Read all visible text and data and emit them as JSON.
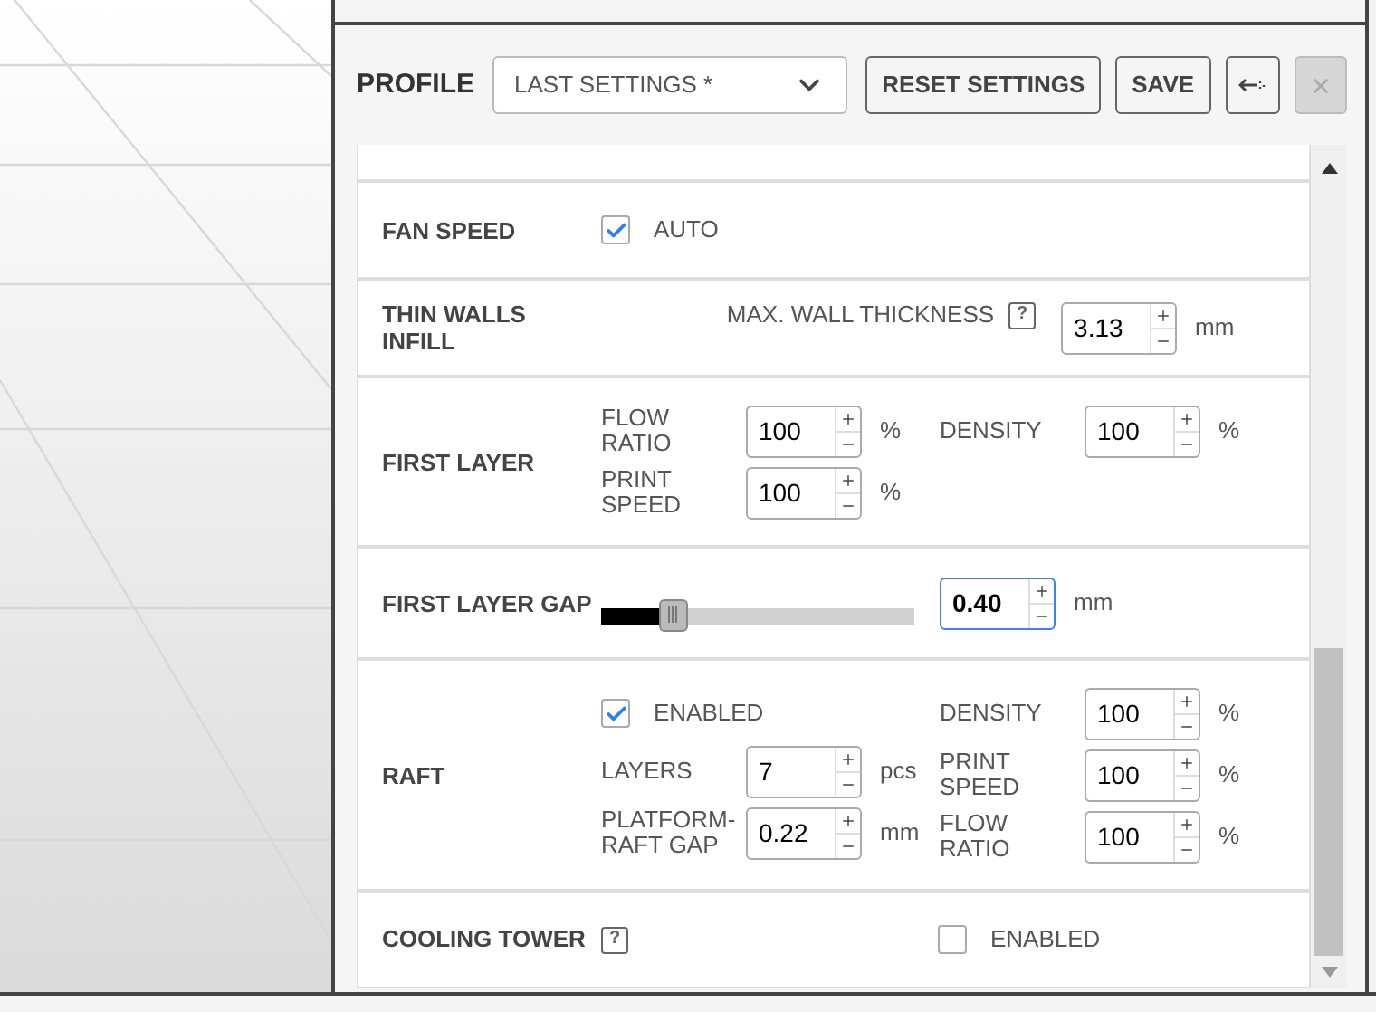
{
  "profile": {
    "label": "PROFILE",
    "selector": {
      "value": "LAST SETTINGS *"
    },
    "buttons": [
      {
        "kind": "text",
        "label": "RESET SETTINGS",
        "disabled": false
      },
      {
        "kind": "text",
        "label": "SAVE",
        "disabled": false
      },
      {
        "kind": "export",
        "disabled": false
      },
      {
        "kind": "close",
        "disabled": true
      }
    ]
  },
  "sections": [
    {
      "kind": "check",
      "title": "FAN SPEED",
      "checkbox": {
        "label": "AUTO",
        "checked": true
      }
    },
    {
      "kind": "thin",
      "title": "THIN WALLS INFILL",
      "field": {
        "label": "MAX. WALL THICKNESS",
        "help": "?",
        "value": "3.13",
        "unit": "mm"
      }
    },
    {
      "kind": "grid",
      "title": "FIRST LAYER",
      "left": [
        {
          "kind": "number",
          "label": "FLOW RATIO",
          "value": "100",
          "unit": "%"
        },
        {
          "kind": "number",
          "label": "PRINT SPEED",
          "value": "100",
          "unit": "%"
        }
      ],
      "right": [
        {
          "kind": "number",
          "label": "DENSITY",
          "value": "100",
          "unit": "%"
        }
      ]
    },
    {
      "kind": "slider",
      "title": "FIRST LAYER GAP",
      "level": 0.23,
      "value": "0.40",
      "unit": "mm",
      "focused": true
    },
    {
      "kind": "grid",
      "title": "RAFT",
      "left": [
        {
          "kind": "checkbox",
          "label": "ENABLED",
          "checked": true
        },
        {
          "kind": "number",
          "label": "LAYERS",
          "value": "7",
          "unit": "pcs"
        },
        {
          "kind": "number",
          "label": "PLATFORM-RAFT GAP",
          "value": "0.22",
          "unit": "mm"
        }
      ],
      "right": [
        {
          "kind": "number",
          "label": "DENSITY",
          "value": "100",
          "unit": "%"
        },
        {
          "kind": "number",
          "label": "PRINT SPEED",
          "value": "100",
          "unit": "%"
        },
        {
          "kind": "number",
          "label": "FLOW RATIO",
          "value": "100",
          "unit": "%"
        }
      ]
    },
    {
      "kind": "check_right",
      "title": "COOLING TOWER",
      "help": "?",
      "checkbox": {
        "label": "ENABLED",
        "checked": false
      }
    }
  ]
}
